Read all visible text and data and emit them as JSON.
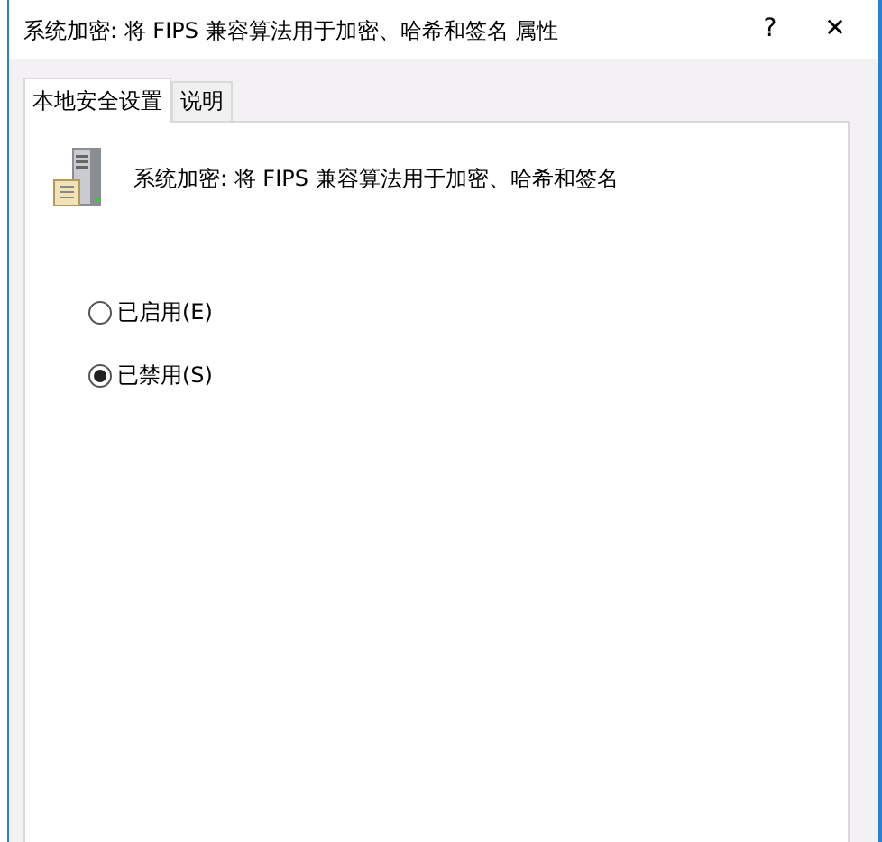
{
  "window": {
    "title": "系统加密: 将 FIPS 兼容算法用于加密、哈希和签名 属性",
    "help": "?",
    "close": "✕"
  },
  "tabs": [
    {
      "label": "本地安全设置",
      "selected": true
    },
    {
      "label": "说明",
      "selected": false
    }
  ],
  "policy": {
    "name": "系统加密: 将 FIPS 兼容算法用于加密、哈希和签名"
  },
  "options": [
    {
      "label": "已启用(E)",
      "selected": false
    },
    {
      "label": "已禁用(S)",
      "selected": true
    }
  ]
}
